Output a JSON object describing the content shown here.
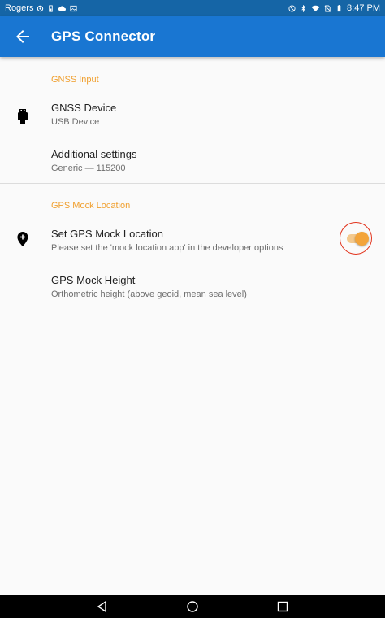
{
  "status_bar": {
    "carrier": "Rogers",
    "time": "8:47 PM"
  },
  "app_bar": {
    "title": "GPS Connector"
  },
  "sections": {
    "gnss_input": {
      "header": "GNSS Input",
      "items": [
        {
          "title": "GNSS Device",
          "summary": "USB Device",
          "icon": "usb-icon"
        },
        {
          "title": "Additional settings",
          "summary": "Generic — 115200"
        }
      ]
    },
    "gps_mock_location": {
      "header": "GPS Mock Location",
      "items": [
        {
          "title": "Set GPS Mock Location",
          "summary": "Please set the 'mock location app' in the developer options",
          "icon": "add-location-icon",
          "switch_on": true
        },
        {
          "title": "GPS Mock Height",
          "summary": "Orthometric height (above geoid, mean sea level)"
        }
      ]
    }
  },
  "colors": {
    "status_bar": "#1565a6",
    "app_bar": "#1976d2",
    "accent": "#f0a030",
    "highlight_ring": "#e2331c"
  }
}
